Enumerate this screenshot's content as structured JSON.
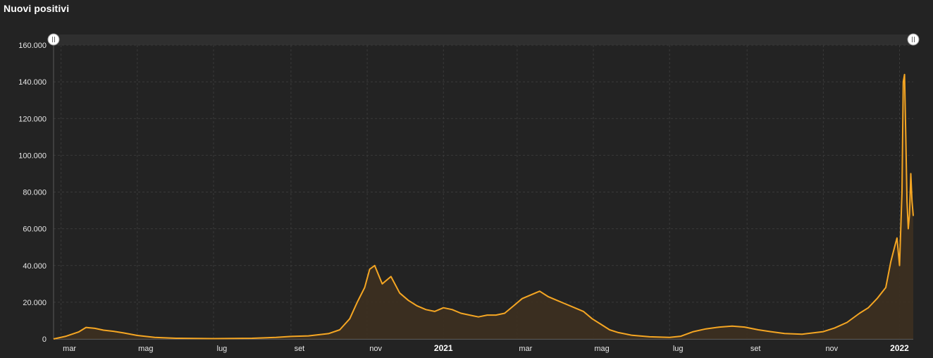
{
  "chart_title": "Nuovi positivi",
  "colors": {
    "background": "#232323",
    "line": "#f5a623",
    "area": "#3d3020",
    "grid": "#3a3a3a",
    "navigator": "#3a3a3a"
  },
  "chart_data": {
    "type": "area",
    "title": "Nuovi positivi",
    "xlabel": "",
    "ylabel": "",
    "ylim": [
      0,
      160000
    ],
    "xlim": [
      "2020-02-24",
      "2022-01-12"
    ],
    "y_ticks": [
      0,
      20000,
      40000,
      60000,
      80000,
      100000,
      120000,
      140000,
      160000
    ],
    "y_tick_labels": [
      "0",
      "20.000",
      "40.000",
      "60.000",
      "80.000",
      "100.000",
      "120.000",
      "140.000",
      "160.000"
    ],
    "x_ticks": [
      {
        "date": "2020-03-01",
        "label": "mar",
        "major": false
      },
      {
        "date": "2020-05-01",
        "label": "mag",
        "major": false
      },
      {
        "date": "2020-07-01",
        "label": "lug",
        "major": false
      },
      {
        "date": "2020-09-01",
        "label": "set",
        "major": false
      },
      {
        "date": "2020-11-01",
        "label": "nov",
        "major": false
      },
      {
        "date": "2021-01-01",
        "label": "2021",
        "major": true
      },
      {
        "date": "2021-03-01",
        "label": "mar",
        "major": false
      },
      {
        "date": "2021-05-01",
        "label": "mag",
        "major": false
      },
      {
        "date": "2021-07-01",
        "label": "lug",
        "major": false
      },
      {
        "date": "2021-09-01",
        "label": "set",
        "major": false
      },
      {
        "date": "2021-11-01",
        "label": "nov",
        "major": false
      },
      {
        "date": "2022-01-01",
        "label": "2022",
        "major": true
      }
    ],
    "grid": true,
    "series": [
      {
        "x": [
          "2020-02-24",
          "2020-03-05",
          "2020-03-15",
          "2020-03-21",
          "2020-03-28",
          "2020-04-04",
          "2020-04-12",
          "2020-04-20",
          "2020-05-01",
          "2020-05-15",
          "2020-06-01",
          "2020-07-01",
          "2020-08-01",
          "2020-08-20",
          "2020-09-01",
          "2020-09-15",
          "2020-10-01",
          "2020-10-10",
          "2020-10-18",
          "2020-10-24",
          "2020-10-30",
          "2020-11-03",
          "2020-11-07",
          "2020-11-13",
          "2020-11-20",
          "2020-11-27",
          "2020-12-04",
          "2020-12-11",
          "2020-12-18",
          "2020-12-25",
          "2021-01-01",
          "2021-01-08",
          "2021-01-15",
          "2021-01-22",
          "2021-01-29",
          "2021-02-05",
          "2021-02-12",
          "2021-02-19",
          "2021-02-26",
          "2021-03-05",
          "2021-03-12",
          "2021-03-19",
          "2021-03-26",
          "2021-04-02",
          "2021-04-09",
          "2021-04-16",
          "2021-04-23",
          "2021-04-30",
          "2021-05-07",
          "2021-05-14",
          "2021-05-21",
          "2021-06-01",
          "2021-06-15",
          "2021-07-01",
          "2021-07-10",
          "2021-07-20",
          "2021-07-30",
          "2021-08-10",
          "2021-08-20",
          "2021-08-30",
          "2021-09-10",
          "2021-09-20",
          "2021-10-01",
          "2021-10-15",
          "2021-11-01",
          "2021-11-10",
          "2021-11-20",
          "2021-11-30",
          "2021-12-07",
          "2021-12-14",
          "2021-12-21",
          "2021-12-25",
          "2021-12-28",
          "2021-12-30",
          "2022-01-01",
          "2022-01-03",
          "2022-01-04",
          "2022-01-05",
          "2022-01-06",
          "2022-01-07",
          "2022-01-08",
          "2022-01-09",
          "2022-01-10",
          "2022-01-11",
          "2022-01-12"
        ],
        "values": [
          0,
          1500,
          3800,
          6300,
          5800,
          4800,
          4200,
          3300,
          1900,
          900,
          400,
          200,
          400,
          900,
          1400,
          1700,
          2900,
          5000,
          11000,
          20000,
          28000,
          38000,
          40000,
          30000,
          34000,
          25000,
          21000,
          18000,
          16000,
          15000,
          17000,
          16000,
          14000,
          13000,
          12000,
          13000,
          13000,
          14000,
          18000,
          22000,
          24000,
          26000,
          23000,
          21000,
          19000,
          17000,
          15000,
          11000,
          8000,
          5000,
          3500,
          2000,
          1200,
          900,
          1500,
          4000,
          5500,
          6500,
          7000,
          6500,
          5000,
          4000,
          3000,
          2600,
          4000,
          6000,
          9000,
          14000,
          17000,
          22000,
          28000,
          42000,
          50000,
          55000,
          40000,
          80000,
          140000,
          144000,
          110000,
          75000,
          60000,
          68000,
          90000,
          75000,
          67000
        ]
      }
    ]
  }
}
